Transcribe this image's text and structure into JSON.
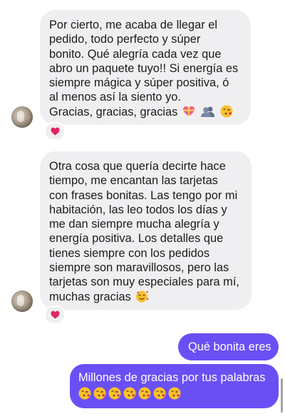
{
  "conversation": {
    "messages": [
      {
        "direction": "incoming",
        "lines": [
          "Por cierto, me acaba de llegar el",
          "pedido, todo perfecto y súper",
          "bonito. Qué alegría cada vez que",
          "abro un paquete tuyo!! Si energía es",
          "siempre mágica y súper positiva, ó",
          "al menos así la siento yo.",
          "Gracias, gracias, gracias"
        ],
        "trailing_emojis": [
          "heart-gift-emoji",
          "busts-emoji",
          "face-blowing-kiss-emoji"
        ],
        "reaction": "red-heart"
      },
      {
        "direction": "incoming",
        "lines": [
          "Otra cosa que quería decirte hace",
          "tiempo, me encantan las tarjetas",
          "con frases bonitas. Las tengo por mi",
          "habitación, las leo todos los días y",
          "me dan siempre mucha alegría y",
          "energía positiva. Los detalles que",
          "tienes siempre con los pedidos",
          "siempre son maravillosos, pero las",
          "tarjetas son muy especiales para mí,",
          "muchas gracias"
        ],
        "trailing_emojis": [
          "smiling-face-with-hearts-emoji"
        ],
        "reaction": "red-heart"
      },
      {
        "direction": "outgoing",
        "lines": [
          "Qué bonita eres"
        ]
      },
      {
        "direction": "outgoing",
        "lines": [
          "Millones de gracias por tus palabras"
        ],
        "emoji_count": 7,
        "emoji": "face-blowing-kiss-emoji"
      }
    ]
  },
  "colors": {
    "incoming_bubble": "#efeff1",
    "outgoing_bubble": "#6a4ff5",
    "reaction_heart": "#e0245e",
    "emoji_yellow": "#fbc02d"
  }
}
